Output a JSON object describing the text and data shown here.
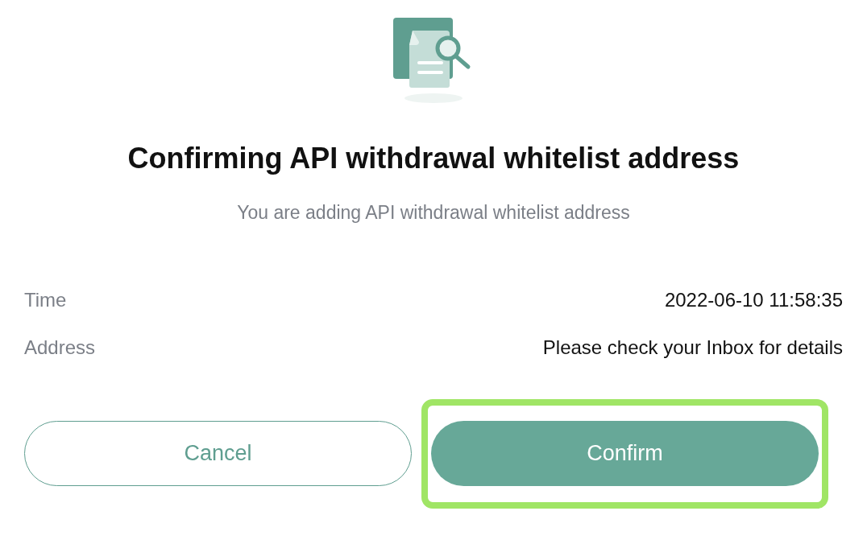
{
  "dialog": {
    "title": "Confirming API withdrawal whitelist address",
    "subtitle": "You are adding API withdrawal whitelist address"
  },
  "details": [
    {
      "label": "Time",
      "value": "2022-06-10 11:58:35"
    },
    {
      "label": "Address",
      "value": "Please check your Inbox for details"
    }
  ],
  "buttons": [
    {
      "label": "Cancel",
      "kind": "outline",
      "highlighted": false
    },
    {
      "label": "Confirm",
      "kind": "filled",
      "highlighted": true
    }
  ]
}
